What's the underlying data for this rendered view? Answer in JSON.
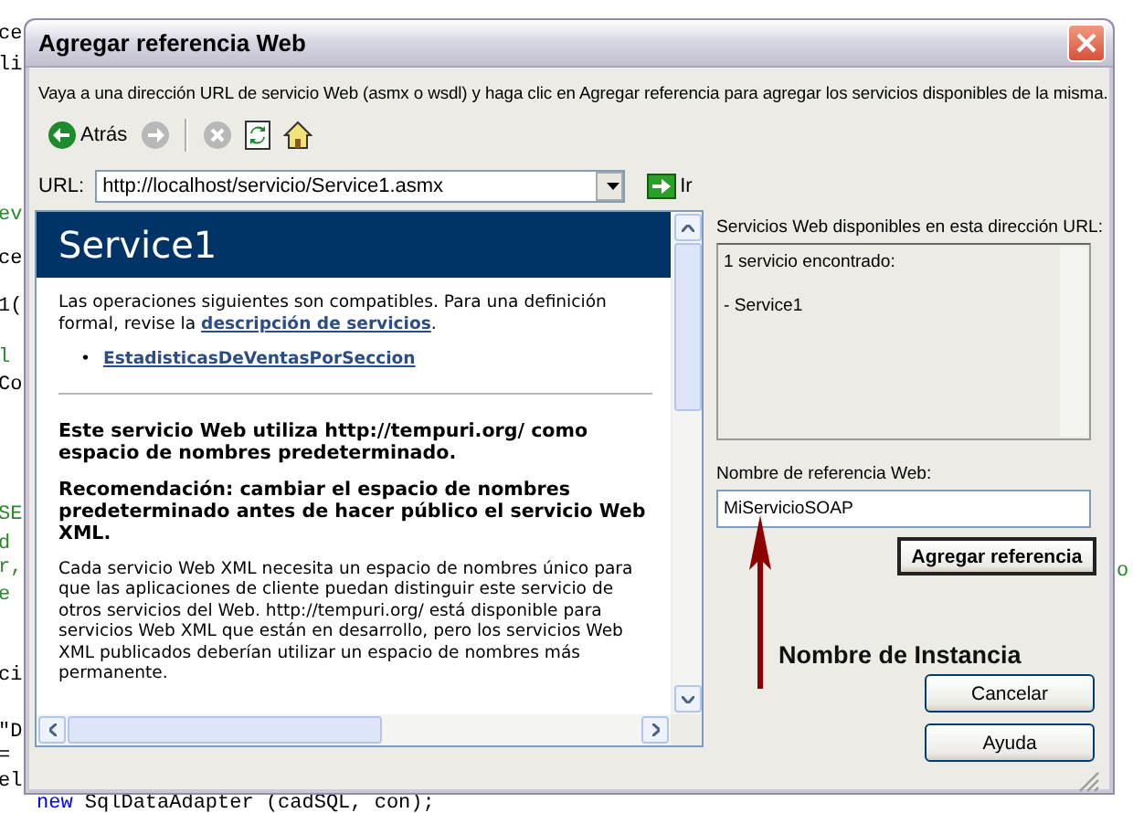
{
  "background_code": {
    "fragments": [
      {
        "text": "ce",
        "kind": "code"
      },
      {
        "text": "li",
        "kind": "code"
      },
      {
        "text": "ev",
        "kind": "comment"
      },
      {
        "text": "ce",
        "kind": "code"
      },
      {
        "text": "1(",
        "kind": "code"
      },
      {
        "text": "l",
        "kind": "comment"
      },
      {
        "text": "Co",
        "kind": "code"
      },
      {
        "text": "SE",
        "kind": "comment"
      },
      {
        "text": "d",
        "kind": "comment"
      },
      {
        "text": "r,",
        "kind": "comment"
      },
      {
        "text": "e",
        "kind": "comment"
      },
      {
        "text": "ci",
        "kind": "code"
      },
      {
        "text": "\"D",
        "kind": "code"
      },
      {
        "text": "=",
        "kind": "code"
      },
      {
        "text": "el",
        "kind": "code"
      }
    ],
    "right_fragment": {
      "text": "o",
      "kind": "comment"
    },
    "bottom_line": [
      {
        "text": "new",
        "kind": "keyword"
      },
      {
        "text": "SqlDataAdapter (cadSQL, con);",
        "kind": "code"
      }
    ]
  },
  "window": {
    "title": "Agregar referencia Web"
  },
  "instructions": "Vaya a una dirección URL de servicio Web (asmx o wsdl) y haga clic en Agregar referencia para agregar los servicios disponibles de la misma.",
  "toolbar": [
    {
      "kind": "back",
      "label": "Atrás",
      "disabled": false
    },
    {
      "kind": "forward",
      "disabled": true
    },
    {
      "kind": "stop",
      "disabled": true
    },
    {
      "kind": "refresh",
      "disabled": false
    },
    {
      "kind": "home",
      "disabled": false
    }
  ],
  "url": {
    "label": "URL:",
    "value": "http://localhost/servicio/Service1.asmx",
    "go_label": "Ir"
  },
  "browser": {
    "heading": "Service1",
    "intro_before": "Las operaciones siguientes son compatibles. Para una definición formal, revise la ",
    "intro_link": "descripción de servicios",
    "intro_after": ".",
    "operations": [
      {
        "marker": "•",
        "name": "EstadisticasDeVentasPorSeccion"
      }
    ],
    "notes": [
      {
        "kind": "bold",
        "text": "Este servicio Web utiliza http://tempuri.org/ como espacio de nombres predeterminado."
      },
      {
        "kind": "bold",
        "text": "Recomendación: cambiar el espacio de nombres predeterminado antes de hacer público el servicio Web XML."
      },
      {
        "kind": "plain",
        "text": "Cada servicio Web XML necesita un espacio de nombres único para que las aplicaciones de cliente puedan distinguir este servicio de otros servicios del Web. http://tempuri.org/ está disponible para servicios Web XML que están en desarrollo, pero los servicios Web XML publicados deberían utilizar un espacio de nombres más permanente."
      }
    ]
  },
  "side": {
    "services_label": "Servicios Web disponibles en esta dirección URL:",
    "services": [
      "1 servicio encontrado:",
      "- Service1"
    ],
    "name_label": "Nombre de referencia Web:",
    "name_value": "MiServicioSOAP",
    "add_button": "Agregar referencia",
    "annotation": "Nombre de Instancia",
    "buttons": [
      "Cancelar",
      "Ayuda"
    ]
  }
}
